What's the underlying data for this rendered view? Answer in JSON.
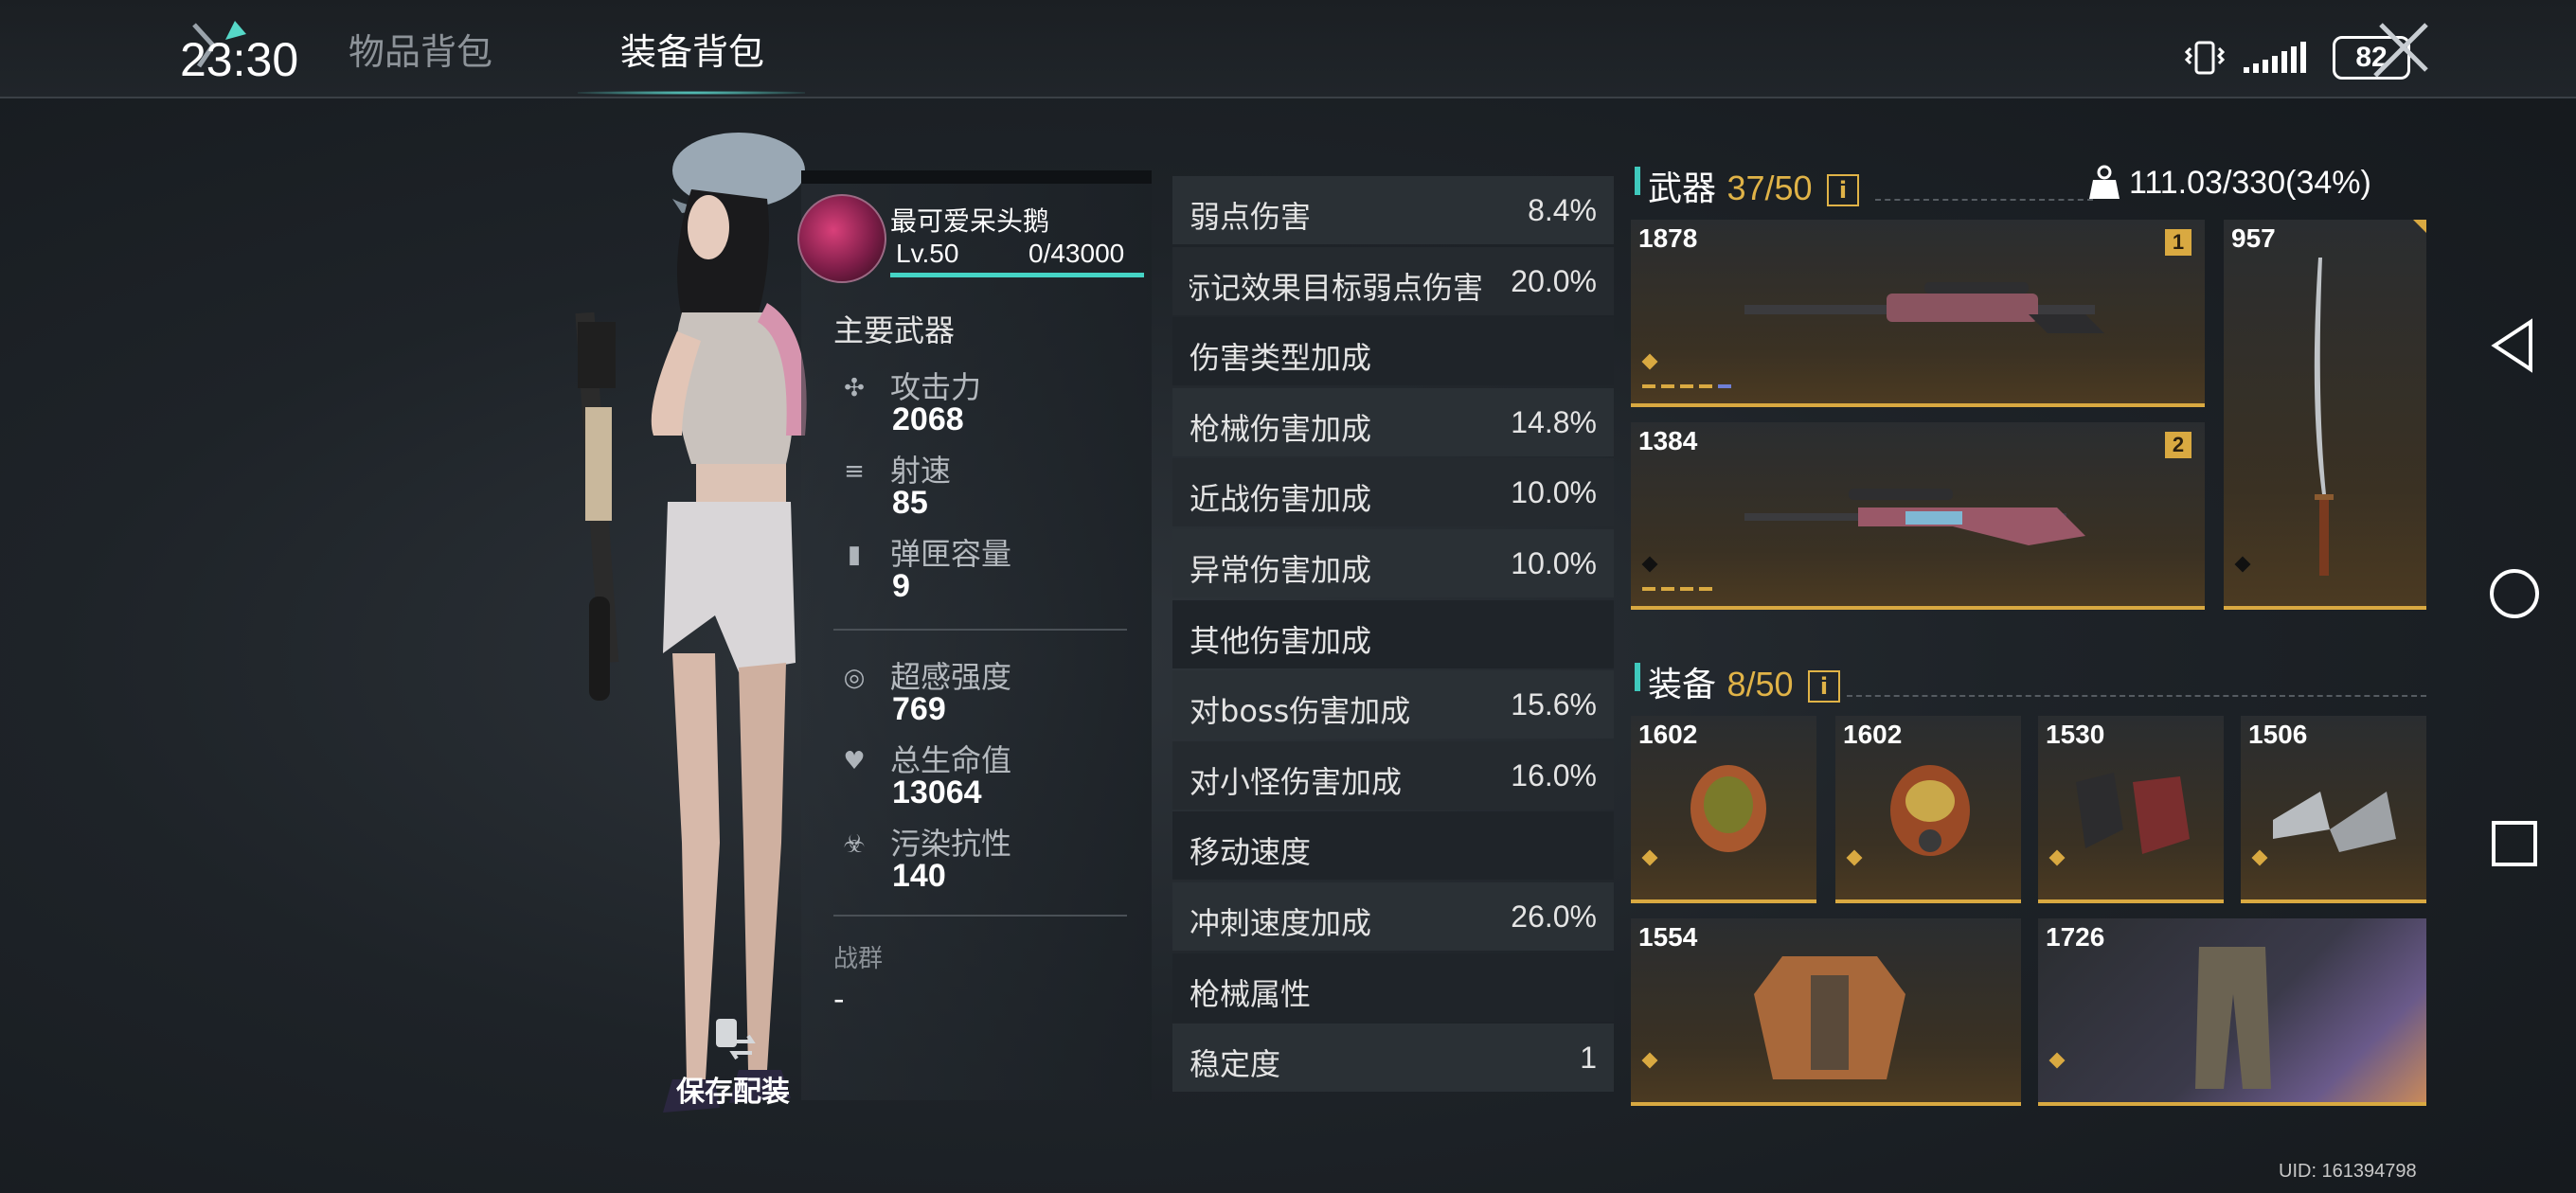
{
  "status_bar": {
    "time": "23:30",
    "battery": "82"
  },
  "tabs": [
    {
      "label": "物品背包",
      "active": false
    },
    {
      "label": "装备背包",
      "active": true
    }
  ],
  "player": {
    "name": "最可爱呆头鹅",
    "level": "Lv.50",
    "exp": "0/43000"
  },
  "primary_weapon": {
    "title": "主要武器",
    "stats": [
      {
        "label": "攻击力",
        "value": "2068",
        "icon": "crosshair-icon"
      },
      {
        "label": "射速",
        "value": "85",
        "icon": "bullets-icon"
      },
      {
        "label": "弹匣容量",
        "value": "9",
        "icon": "magazine-icon"
      }
    ]
  },
  "character_stats": [
    {
      "label": "超感强度",
      "value": "769",
      "icon": "psi-icon"
    },
    {
      "label": "总生命值",
      "value": "13064",
      "icon": "heart-icon"
    },
    {
      "label": "污染抗性",
      "value": "140",
      "icon": "biohazard-icon"
    }
  ],
  "guild": {
    "label": "战群",
    "value": "-"
  },
  "save_loadout": "保存配装",
  "attributes": [
    {
      "name": "弱点伤害",
      "value": "8.4%",
      "header": false
    },
    {
      "name": "标记效果目标弱点伤害",
      "value": "20.0%",
      "header": false
    },
    {
      "name": "伤害类型加成",
      "value": "",
      "header": true
    },
    {
      "name": "枪械伤害加成",
      "value": "14.8%",
      "header": false
    },
    {
      "name": "近战伤害加成",
      "value": "10.0%",
      "header": false
    },
    {
      "name": "异常伤害加成",
      "value": "10.0%",
      "header": false
    },
    {
      "name": "其他伤害加成",
      "value": "",
      "header": true
    },
    {
      "name": "对boss伤害加成",
      "value": "15.6%",
      "header": false
    },
    {
      "name": "对小怪伤害加成",
      "value": "16.0%",
      "header": false
    },
    {
      "name": "移动速度",
      "value": "",
      "header": true
    },
    {
      "name": "冲刺速度加成",
      "value": "26.0%",
      "header": false
    },
    {
      "name": "枪械属性",
      "value": "",
      "header": true
    },
    {
      "name": "稳定度",
      "value": "1",
      "header": false
    }
  ],
  "weapons_section": {
    "title": "武器",
    "count": "37/50",
    "info_icon": "i",
    "weight": "111.03/330(34%)",
    "items": [
      {
        "power": "1878",
        "slot": "1",
        "type": "sniper-rifle-icon"
      },
      {
        "power": "1384",
        "slot": "2",
        "type": "bolt-rifle-icon"
      },
      {
        "power": "957",
        "slot": "",
        "type": "katana-icon"
      }
    ]
  },
  "gear_section": {
    "title": "装备",
    "count": "8/50",
    "info_icon": "i",
    "items": [
      {
        "power": "1602",
        "type": "helmet-icon"
      },
      {
        "power": "1602",
        "type": "gas-mask-icon"
      },
      {
        "power": "1530",
        "type": "gloves-icon"
      },
      {
        "power": "1506",
        "type": "boots-icon"
      },
      {
        "power": "1554",
        "type": "armor-vest-icon"
      },
      {
        "power": "1726",
        "type": "pants-icon"
      }
    ]
  },
  "uid": "UID: 161394798",
  "colors": {
    "accent": "#3fc9bd",
    "gold": "#d9a941",
    "count": "#e0b347"
  }
}
